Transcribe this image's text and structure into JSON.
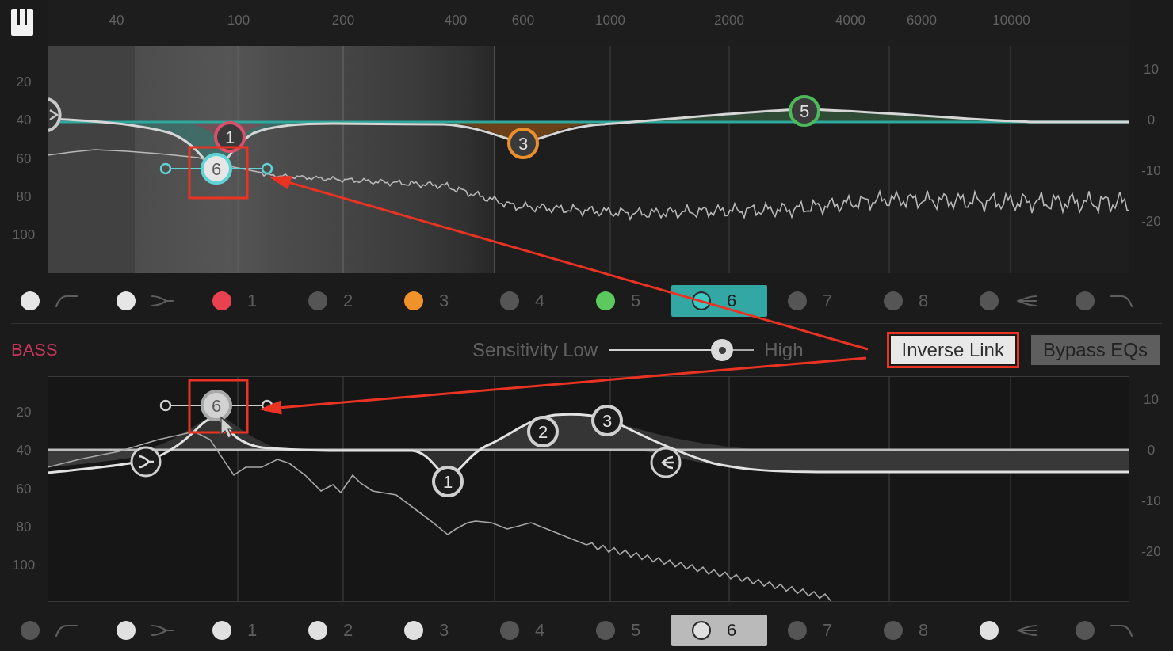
{
  "top_panel": {
    "frequency_labels": [
      "40",
      "100",
      "200",
      "400",
      "600",
      "1000",
      "2000",
      "4000",
      "6000",
      "10000"
    ],
    "left_axis_labels": [
      "20",
      "40",
      "60",
      "80",
      "100"
    ],
    "right_axis_labels": [
      "10",
      "0",
      "-10",
      "-20"
    ],
    "nodes": [
      {
        "kind": "lowshelf",
        "color": "#c8c8c8",
        "selected": false,
        "highlighted": false
      },
      {
        "kind": "band",
        "label": "6",
        "color": "#5fd3d6",
        "selected": true,
        "highlighted": true
      },
      {
        "kind": "band",
        "label": "1",
        "color": "#d9506a",
        "selected": false,
        "highlighted": false
      },
      {
        "kind": "band",
        "label": "3",
        "color": "#ea8f2c",
        "selected": false,
        "highlighted": false
      },
      {
        "kind": "band",
        "label": "5",
        "color": "#4cba5a",
        "selected": false,
        "highlighted": false
      }
    ],
    "bands": [
      {
        "kind": "lowcut",
        "color": "#e6e6e6",
        "selected": false
      },
      {
        "kind": "lowshelf",
        "color": "#e6e6e6",
        "selected": false
      },
      {
        "kind": "band",
        "label": "1",
        "color": "#e8414f",
        "selected": false
      },
      {
        "kind": "band",
        "label": "2",
        "color": "#555555",
        "selected": false
      },
      {
        "kind": "band",
        "label": "3",
        "color": "#f0922a",
        "selected": false
      },
      {
        "kind": "band",
        "label": "4",
        "color": "#555555",
        "selected": false
      },
      {
        "kind": "band",
        "label": "5",
        "color": "#5cc95e",
        "selected": false
      },
      {
        "kind": "band",
        "label": "6",
        "color": "#3cc9c4",
        "selected": true
      },
      {
        "kind": "band",
        "label": "7",
        "color": "#555555",
        "selected": false
      },
      {
        "kind": "band",
        "label": "8",
        "color": "#555555",
        "selected": false
      },
      {
        "kind": "highshelf",
        "color": "#555555",
        "selected": false
      },
      {
        "kind": "highcut",
        "color": "#555555",
        "selected": false
      }
    ]
  },
  "section_label": "BASS",
  "sensitivity": {
    "label": "Sensitivity",
    "low_label": "Low",
    "high_label": "High",
    "level": 0.78
  },
  "buttons": [
    {
      "label": "Inverse Link",
      "on": true,
      "highlighted": true
    },
    {
      "label": "Bypass EQs",
      "on": false,
      "highlighted": false
    }
  ],
  "bottom_panel": {
    "left_axis_labels": [
      "20",
      "40",
      "60",
      "80",
      "100"
    ],
    "right_axis_labels": [
      "10",
      "0",
      "-10",
      "-20"
    ],
    "nodes": [
      {
        "kind": "lowshelf",
        "selected": false,
        "highlighted": false
      },
      {
        "kind": "band",
        "label": "6",
        "selected": true,
        "highlighted": true
      },
      {
        "kind": "band",
        "label": "1",
        "selected": false,
        "highlighted": false
      },
      {
        "kind": "band",
        "label": "2",
        "selected": false,
        "highlighted": false
      },
      {
        "kind": "band",
        "label": "3",
        "selected": false,
        "highlighted": false
      },
      {
        "kind": "highshelf",
        "selected": false,
        "highlighted": false
      }
    ],
    "bands": [
      {
        "kind": "lowcut",
        "color": "#555555",
        "selected": false
      },
      {
        "kind": "lowshelf",
        "color": "#e0e0e0",
        "selected": false
      },
      {
        "kind": "band",
        "label": "1",
        "color": "#e0e0e0",
        "selected": false
      },
      {
        "kind": "band",
        "label": "2",
        "color": "#e0e0e0",
        "selected": false
      },
      {
        "kind": "band",
        "label": "3",
        "color": "#e0e0e0",
        "selected": false
      },
      {
        "kind": "band",
        "label": "4",
        "color": "#555555",
        "selected": false
      },
      {
        "kind": "band",
        "label": "5",
        "color": "#555555",
        "selected": false
      },
      {
        "kind": "band",
        "label": "6",
        "color": "#e0e0e0",
        "selected": true
      },
      {
        "kind": "band",
        "label": "7",
        "color": "#555555",
        "selected": false
      },
      {
        "kind": "band",
        "label": "8",
        "color": "#555555",
        "selected": false
      },
      {
        "kind": "highshelf",
        "color": "#e0e0e0",
        "selected": false
      },
      {
        "kind": "highcut",
        "color": "#555555",
        "selected": false
      }
    ]
  }
}
